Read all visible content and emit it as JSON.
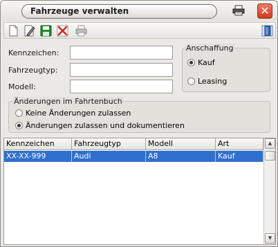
{
  "window": {
    "title": "Fahrzeuge verwalten",
    "close_glyph": "✕"
  },
  "toolbar": {
    "buttons": [
      "new-document-icon",
      "edit-icon",
      "save-icon",
      "delete-icon",
      "print-icon"
    ],
    "right_button": "exit-door-icon"
  },
  "form": {
    "kennzeichen_label": "Kennzeichen:",
    "kennzeichen_value": "",
    "fahrzeugtyp_label": "Fahrzeugtyp:",
    "fahrzeugtyp_value": "",
    "modell_label": "Modell:",
    "modell_value": ""
  },
  "anschaffung": {
    "title": "Anschaffung",
    "options": [
      {
        "label": "Kauf",
        "checked": true
      },
      {
        "label": "Leasing",
        "checked": false
      }
    ]
  },
  "aenderungen": {
    "title": "Änderungen im Fahrtenbuch",
    "options": [
      {
        "label": "Keine Änderungen zulassen",
        "checked": false
      },
      {
        "label": "Änderungen zulassen und dokumentieren",
        "checked": true
      }
    ]
  },
  "table": {
    "columns": [
      "Kennzeichen",
      "Fahrzeugtyp",
      "Modell",
      "Art"
    ],
    "rows": [
      [
        "XX-XX-999",
        "Audi",
        "A8",
        "Kauf"
      ]
    ]
  },
  "colors": {
    "selection": "#2f6fcd",
    "close_button": "#cf3a21",
    "save_icon": "#1f8a2c",
    "delete_icon": "#cc2a1a"
  }
}
